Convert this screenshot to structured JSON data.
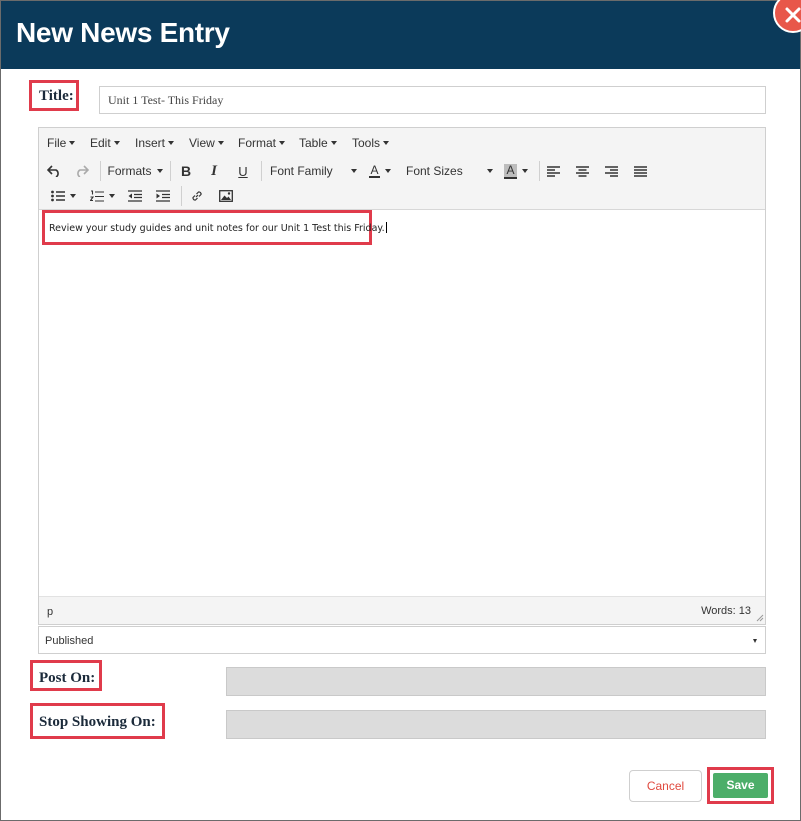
{
  "dialog": {
    "title": "New News Entry"
  },
  "form": {
    "title_label": "Title:",
    "title_value": "Unit 1 Test- This Friday",
    "post_on_label": "Post On:",
    "stop_showing_label": "Stop Showing On:",
    "post_on_value": "",
    "stop_showing_value": ""
  },
  "editor": {
    "menu": [
      "File",
      "Edit",
      "Insert",
      "View",
      "Format",
      "Table",
      "Tools"
    ],
    "toolbar": {
      "formats_label": "Formats",
      "bold_label": "B",
      "italic_label": "I",
      "underline_label": "U",
      "font_family_label": "Font Family",
      "text_color_label": "A",
      "font_sizes_label": "Font Sizes",
      "bg_color_label": "A"
    },
    "content_text": "Review your study guides and unit notes for our Unit 1 Test this Friday.",
    "status_path": "p",
    "word_count": "Words: 13"
  },
  "status_select": {
    "selected": "Published"
  },
  "buttons": {
    "cancel": "Cancel",
    "save": "Save"
  },
  "colors": {
    "header_bg": "#0b3a5a",
    "close_button": "#e8574a",
    "highlight_box": "#e03b4b",
    "save_button": "#4cae69",
    "cancel_text": "#e04a3f"
  },
  "icons": {
    "close": "close-icon",
    "undo": "undo-icon",
    "redo": "redo-icon",
    "align_left": "align-left-icon",
    "align_center": "align-center-icon",
    "align_right": "align-right-icon",
    "align_justify": "align-justify-icon",
    "bullet_list": "bullet-list-icon",
    "numbered_list": "numbered-list-icon",
    "outdent": "outdent-icon",
    "indent": "indent-icon",
    "link": "link-icon",
    "image": "image-icon"
  }
}
